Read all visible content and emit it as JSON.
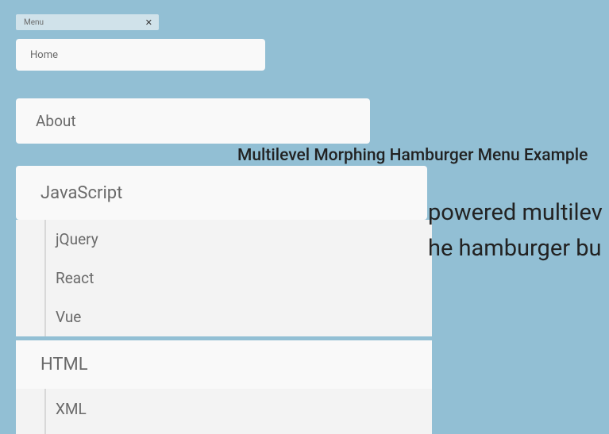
{
  "menu_header": {
    "label": "Menu",
    "close": "✕"
  },
  "menu": {
    "home": "Home",
    "about": "About",
    "javascript": {
      "label": "JavaScript",
      "items": [
        "jQuery",
        "React",
        "Vue"
      ]
    },
    "html": {
      "label": "HTML",
      "items": [
        "XML"
      ]
    }
  },
  "content": {
    "title": "Multilevel Morphing Hamburger Menu Example",
    "line1": "powered multilev",
    "line2": "he hamburger bu"
  }
}
